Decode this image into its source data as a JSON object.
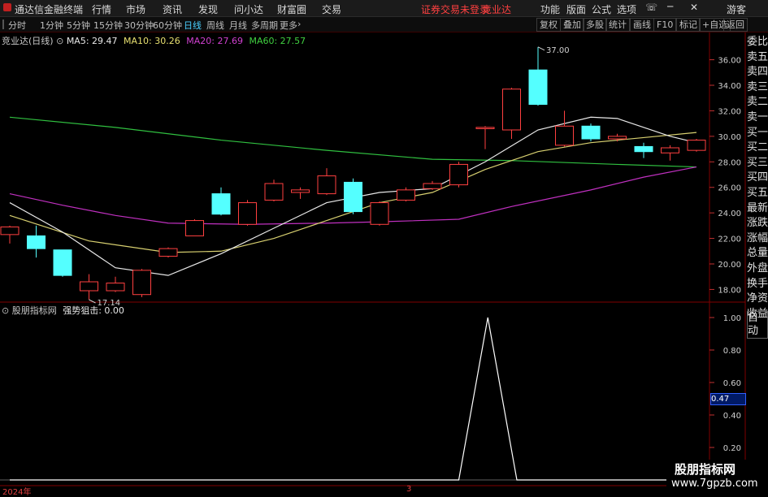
{
  "menubar": {
    "logo_text": "通达信金融终端",
    "items": [
      "行情",
      "市场",
      "资讯",
      "发现",
      "问小达",
      "财富圈",
      "交易"
    ],
    "notice": "证券交易未登录",
    "stock": "竞业达",
    "right_items": [
      "功能",
      "版面",
      "公式",
      "选项"
    ],
    "guest": "游客"
  },
  "toolbar": {
    "periods": [
      "分时",
      "1分钟",
      "5分钟",
      "15分钟",
      "30分钟",
      "60分钟",
      "日线",
      "周线",
      "月线",
      "多周期",
      "更多"
    ],
    "active_period": "日线",
    "buttons": [
      "复权",
      "叠加",
      "多股",
      "统计",
      "画线",
      "F10",
      "标记",
      "+自选",
      "返回"
    ]
  },
  "main_chart": {
    "title": "竞业达(日线)",
    "ma": [
      {
        "label": "MA5: 29.47",
        "color": "#e8e8e8"
      },
      {
        "label": "MA10: 30.26",
        "color": "#e8e070"
      },
      {
        "label": "MA20: 27.69",
        "color": "#d040d0"
      },
      {
        "label": "MA60: 27.57",
        "color": "#40d040"
      }
    ],
    "price_axis": [
      "36.00",
      "34.00",
      "32.00",
      "30.00",
      "28.00",
      "26.00",
      "24.00",
      "22.00",
      "20.00",
      "18.00"
    ],
    "high_mark": "37.00",
    "low_mark": "17.14"
  },
  "indicator": {
    "title": "股朋指标网",
    "name": "强势狙击: 0.00",
    "axis": [
      "1.00",
      "0.80",
      "0.60",
      "0.40",
      "0.20"
    ],
    "current": "0.47"
  },
  "sidebar": [
    "委比",
    "卖五",
    "卖四",
    "卖三",
    "卖二",
    "卖一",
    "买一",
    "买二",
    "买三",
    "买四",
    "买五",
    "最新",
    "涨跌",
    "涨幅",
    "总量",
    "外盘",
    "换手",
    "净资",
    "收益",
    "自动"
  ],
  "bottom_axis": {
    "year": "2024年",
    "month": "3"
  },
  "watermark": {
    "line1": "股朋指标网",
    "line2": "www.7gpzb.com"
  },
  "chart_data": {
    "type": "candlestick",
    "ylim": [
      16.5,
      37.5
    ],
    "candles": [
      {
        "o": 22.3,
        "c": 22.9,
        "h": 23.0,
        "l": 21.6
      },
      {
        "o": 22.2,
        "c": 21.2,
        "h": 23.0,
        "l": 20.5
      },
      {
        "o": 21.1,
        "c": 19.1,
        "h": 21.1,
        "l": 19.0
      },
      {
        "o": 17.9,
        "c": 18.6,
        "h": 19.2,
        "l": 17.2
      },
      {
        "o": 17.9,
        "c": 18.5,
        "h": 19.0,
        "l": 17.8
      },
      {
        "o": 17.6,
        "c": 19.5,
        "h": 19.6,
        "l": 17.4
      },
      {
        "o": 20.6,
        "c": 21.2,
        "h": 21.3,
        "l": 20.5
      },
      {
        "o": 22.2,
        "c": 23.4,
        "h": 23.5,
        "l": 22.2
      },
      {
        "o": 25.5,
        "c": 23.9,
        "h": 26.0,
        "l": 23.8
      },
      {
        "o": 23.1,
        "c": 24.8,
        "h": 25.0,
        "l": 23.0
      },
      {
        "o": 25.0,
        "c": 26.3,
        "h": 26.6,
        "l": 24.9
      },
      {
        "o": 25.6,
        "c": 25.8,
        "h": 26.0,
        "l": 25.1
      },
      {
        "o": 25.5,
        "c": 26.9,
        "h": 27.5,
        "l": 25.4
      },
      {
        "o": 26.4,
        "c": 24.1,
        "h": 26.7,
        "l": 23.9
      },
      {
        "o": 23.1,
        "c": 24.8,
        "h": 24.9,
        "l": 23.0
      },
      {
        "o": 25.0,
        "c": 25.8,
        "h": 26.0,
        "l": 24.9
      },
      {
        "o": 25.9,
        "c": 26.3,
        "h": 26.5,
        "l": 25.8
      },
      {
        "o": 26.2,
        "c": 27.8,
        "h": 28.0,
        "l": 26.0
      },
      {
        "o": 30.6,
        "c": 30.7,
        "h": 30.8,
        "l": 29.0
      },
      {
        "o": 30.5,
        "c": 33.7,
        "h": 33.8,
        "l": 29.8
      },
      {
        "o": 35.2,
        "c": 32.5,
        "h": 37.0,
        "l": 32.4
      },
      {
        "o": 29.3,
        "c": 30.8,
        "h": 32.0,
        "l": 29.2
      },
      {
        "o": 30.8,
        "c": 29.8,
        "h": 31.0,
        "l": 29.6
      },
      {
        "o": 29.8,
        "c": 30.0,
        "h": 30.2,
        "l": 29.6
      },
      {
        "o": 29.2,
        "c": 28.8,
        "h": 29.5,
        "l": 28.3
      },
      {
        "o": 28.7,
        "c": 29.1,
        "h": 29.3,
        "l": 28.1
      },
      {
        "o": 28.9,
        "c": 29.7,
        "h": 29.8,
        "l": 28.8
      }
    ],
    "ma5": [
      [
        0,
        24.8
      ],
      [
        2,
        22.5
      ],
      [
        4,
        19.7
      ],
      [
        6,
        19.1
      ],
      [
        8,
        20.8
      ],
      [
        10,
        22.8
      ],
      [
        12,
        24.8
      ],
      [
        14,
        25.6
      ],
      [
        16,
        25.9
      ],
      [
        18,
        28.0
      ],
      [
        20,
        30.5
      ],
      [
        22,
        31.5
      ],
      [
        23,
        31.4
      ],
      [
        25,
        30.0
      ],
      [
        26,
        29.5
      ]
    ],
    "ma10": [
      [
        0,
        23.8
      ],
      [
        3,
        21.8
      ],
      [
        6,
        20.9
      ],
      [
        8,
        21.0
      ],
      [
        10,
        22.0
      ],
      [
        12,
        23.4
      ],
      [
        14,
        24.8
      ],
      [
        16,
        25.6
      ],
      [
        18,
        27.4
      ],
      [
        20,
        28.8
      ],
      [
        22,
        29.5
      ],
      [
        24,
        29.9
      ],
      [
        26,
        30.3
      ]
    ],
    "ma20": [
      [
        0,
        25.5
      ],
      [
        2,
        24.6
      ],
      [
        4,
        23.8
      ],
      [
        6,
        23.2
      ],
      [
        9,
        23.1
      ],
      [
        12,
        23.2
      ],
      [
        14,
        23.3
      ],
      [
        17,
        23.5
      ],
      [
        19,
        24.5
      ],
      [
        22,
        25.8
      ],
      [
        24,
        26.8
      ],
      [
        26,
        27.6
      ]
    ],
    "ma60": [
      [
        0,
        31.5
      ],
      [
        4,
        30.7
      ],
      [
        8,
        29.7
      ],
      [
        12,
        28.9
      ],
      [
        16,
        28.2
      ],
      [
        19,
        28.1
      ],
      [
        23,
        27.8
      ],
      [
        26,
        27.6
      ]
    ],
    "indicator_series": [
      [
        0,
        0
      ],
      [
        17,
        0
      ],
      [
        18.1,
        1.0
      ],
      [
        19.2,
        0
      ],
      [
        26,
        0
      ]
    ]
  }
}
